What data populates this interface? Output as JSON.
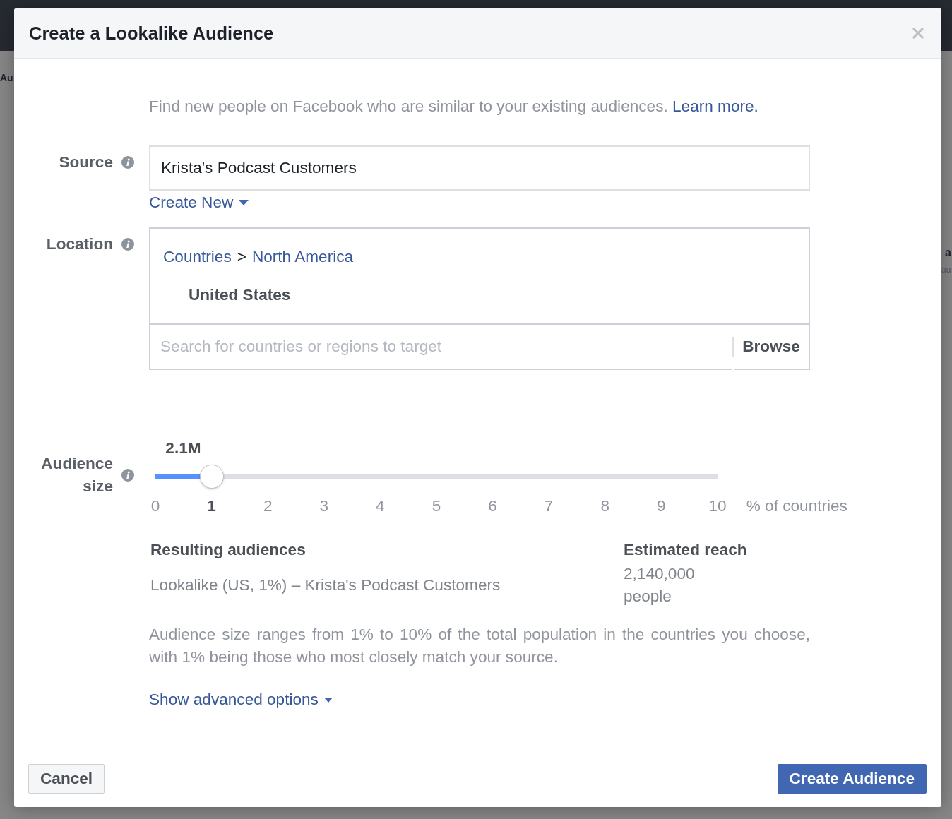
{
  "page_background": {
    "left_edge_text": "Au",
    "right_edge_texts": [
      {
        "text": "a",
        "kind": "heading"
      },
      {
        "text": "au",
        "kind": "subtext"
      }
    ]
  },
  "dialog": {
    "title": "Create a Lookalike Audience",
    "intro": {
      "text": "Find new people on Facebook who are similar to your existing audiences.",
      "link": "Learn more."
    },
    "source": {
      "label": "Source",
      "value": "Krista's Podcast Customers",
      "create_link": "Create New"
    },
    "location": {
      "label": "Location",
      "breadcrumb": [
        "Countries",
        "North America"
      ],
      "breadcrumb_separator": ">",
      "selected_locations": [
        "United States"
      ],
      "search": {
        "placeholder": "Search for countries or regions to target"
      },
      "browse_button": "Browse"
    },
    "audience_size": {
      "label": "Audience size",
      "value_label": "2.1M",
      "level": 0.1,
      "ticks": [
        {
          "label": "0",
          "selected": false
        },
        {
          "label": "1",
          "selected": true
        },
        {
          "label": "2",
          "selected": false
        },
        {
          "label": "3",
          "selected": false
        },
        {
          "label": "4",
          "selected": false
        },
        {
          "label": "5",
          "selected": false
        },
        {
          "label": "6",
          "selected": false
        },
        {
          "label": "7",
          "selected": false
        },
        {
          "label": "8",
          "selected": false
        },
        {
          "label": "9",
          "selected": false
        },
        {
          "label": "10",
          "selected": false
        }
      ],
      "unit": "% of countries"
    },
    "results": {
      "heading": "Resulting audiences",
      "audiences": [
        "Lookalike (US, 1%) – Krista's Podcast Customers"
      ]
    },
    "reach": {
      "heading": "Estimated reach",
      "value": "2,140,000",
      "unit": "people"
    },
    "note": "Audience size ranges from 1% to 10% of the total population in the countries you choose, with 1% being those who most closely match your source.",
    "advanced_link": "Show advanced options",
    "buttons": [
      {
        "label": "Cancel",
        "kind": "secondary"
      },
      {
        "label": "Create Audience",
        "kind": "primary"
      }
    ]
  }
}
